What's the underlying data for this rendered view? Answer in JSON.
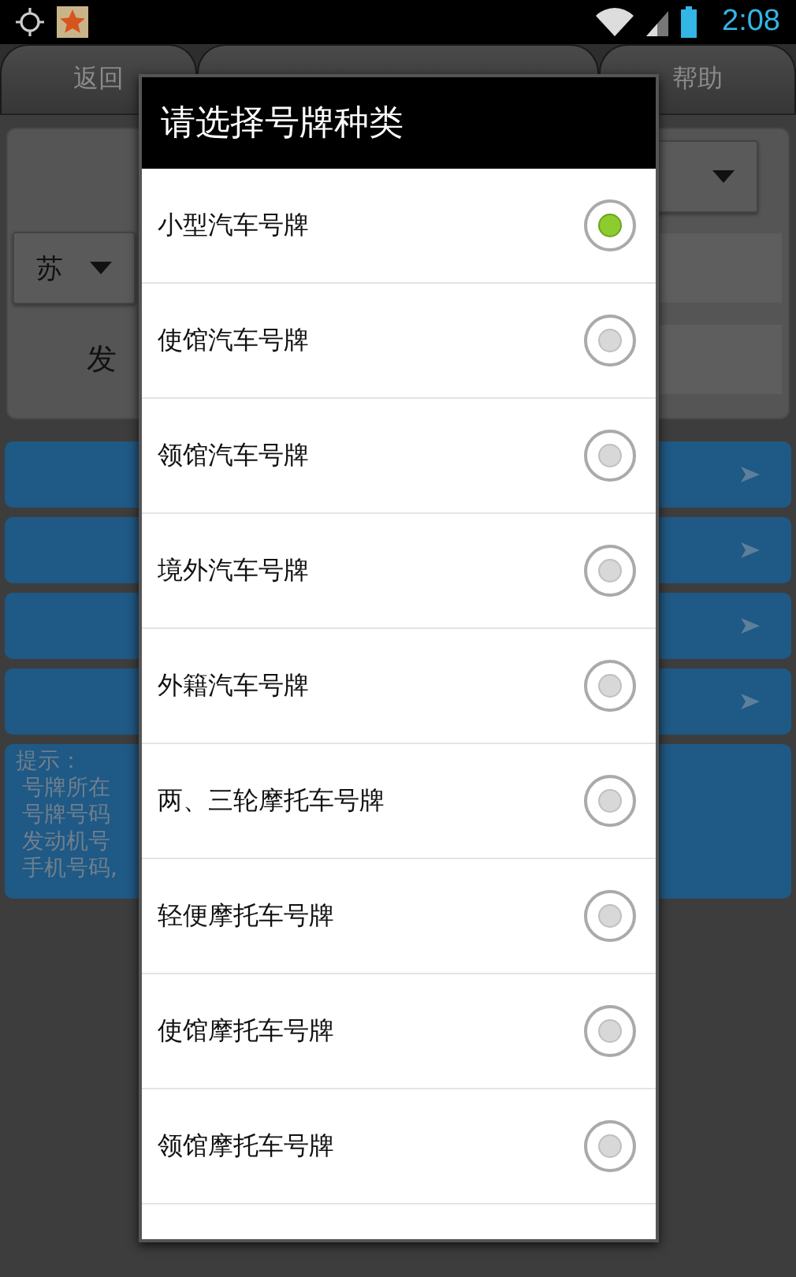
{
  "status_bar": {
    "time": "2:08"
  },
  "tabs": [
    {
      "label": "返回"
    },
    {
      "label": "帮助"
    }
  ],
  "form": {
    "province": "苏",
    "engine_label": "发"
  },
  "tip": {
    "lines": [
      "提示：",
      "号牌所在",
      "号牌号码",
      "发动机号",
      "手机号码,"
    ]
  },
  "dialog": {
    "title": "请选择号牌种类",
    "options": [
      {
        "label": "小型汽车号牌",
        "selected": true
      },
      {
        "label": "使馆汽车号牌",
        "selected": false
      },
      {
        "label": "领馆汽车号牌",
        "selected": false
      },
      {
        "label": "境外汽车号牌",
        "selected": false
      },
      {
        "label": "外籍汽车号牌",
        "selected": false
      },
      {
        "label": "两、三轮摩托车号牌",
        "selected": false
      },
      {
        "label": "轻便摩托车号牌",
        "selected": false
      },
      {
        "label": "使馆摩托车号牌",
        "selected": false
      },
      {
        "label": "领馆摩托车号牌",
        "selected": false
      }
    ]
  }
}
